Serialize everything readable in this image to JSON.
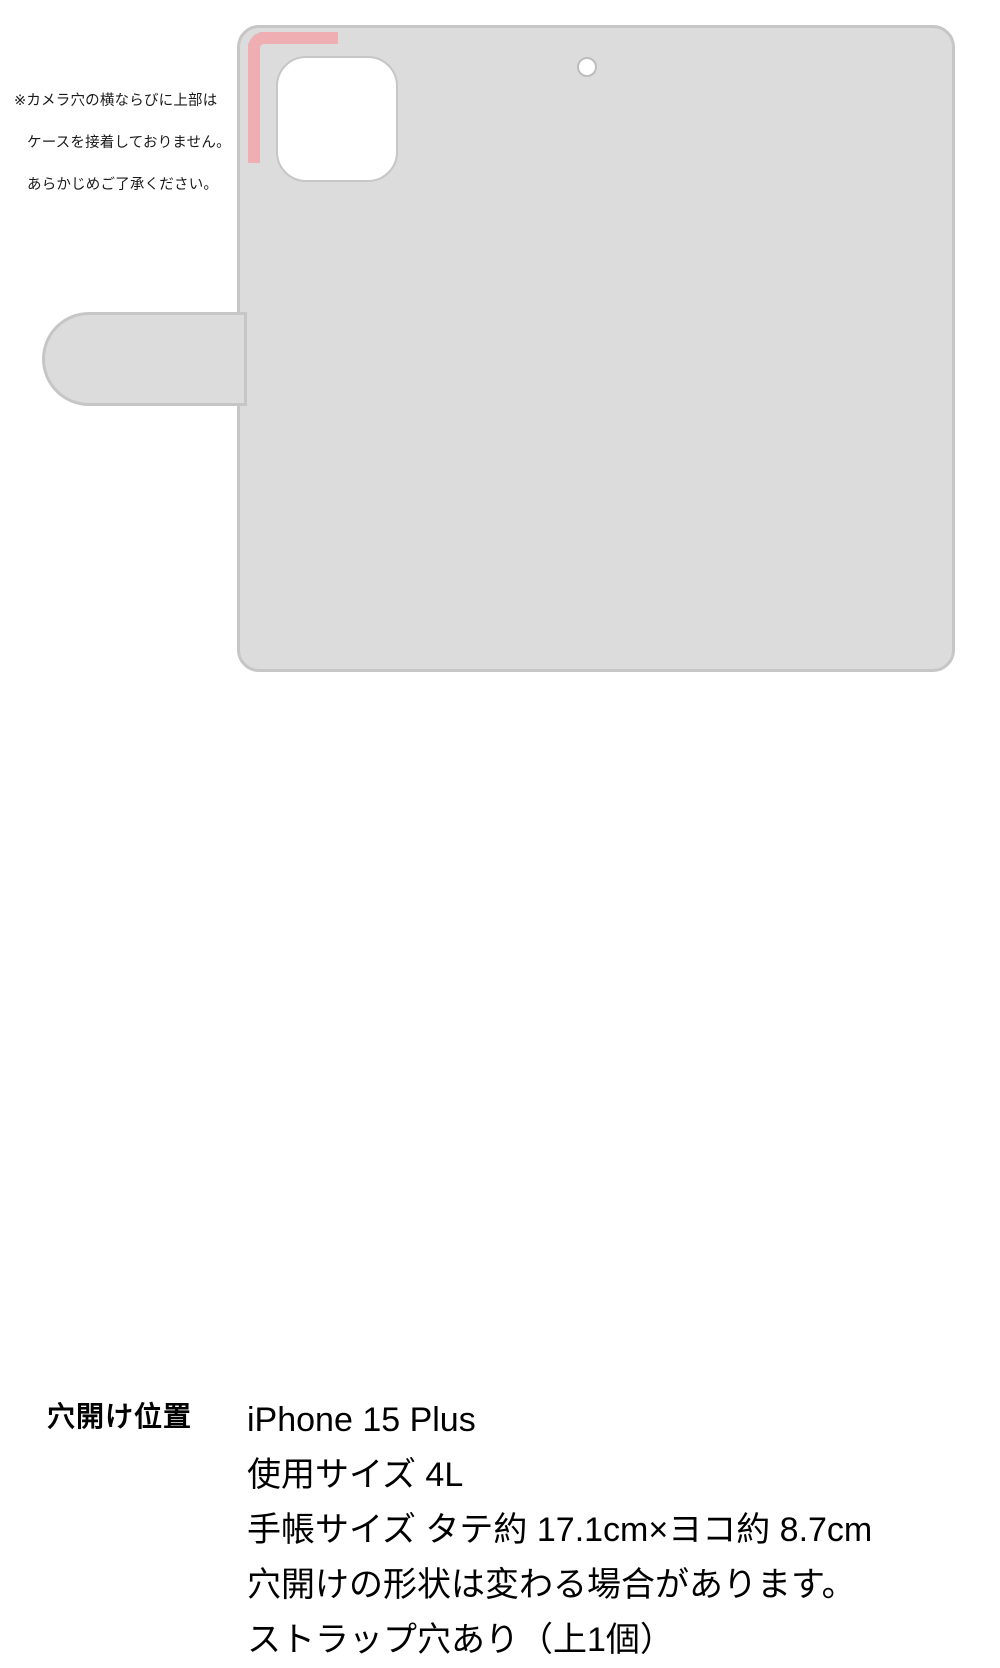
{
  "note": {
    "lines": [
      "※カメラ穴の横ならびに上部は",
      "ケースを接着しておりません。",
      "あらかじめご了承ください。"
    ]
  },
  "diagram": {
    "case_body_name": "phone-case-body",
    "camera_cutout_name": "camera-cutout",
    "strap_hole_name": "strap-hole",
    "side_tab_name": "side-flap-tab",
    "marker_color": "#efaeb1",
    "body_fill": "#dcdcdc",
    "body_border": "#c6c6c6"
  },
  "specs": {
    "label": "穴開け位置",
    "lines": [
      "iPhone 15 Plus",
      "使用サイズ 4L",
      "手帳サイズ タテ約 17.1cm×ヨコ約 8.7cm",
      "穴開けの形状は変わる場合があります。",
      "ストラップ穴あり（上1個）"
    ]
  }
}
